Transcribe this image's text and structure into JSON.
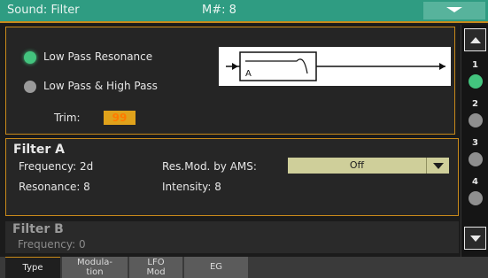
{
  "title_bar": {
    "left_text": "Sound: Filter",
    "center_text": "M#: 8",
    "menu_icon": "chevron-down-icon"
  },
  "filter_type": {
    "option_1": "Low Pass Resonance",
    "option_2": "Low Pass & High Pass",
    "selected": "Low Pass Resonance",
    "trim_label": "Trim:",
    "trim_value": "99"
  },
  "diagram": {
    "letter": "A"
  },
  "filter_a": {
    "heading": "Filter A",
    "frequency": "Frequency: 2d",
    "resonance": "Resonance: 8",
    "res_mod_label": "Res.Mod. by AMS:",
    "res_mod_value": "Off",
    "intensity": "Intensity: 8"
  },
  "filter_b": {
    "heading": "Filter B",
    "frequency": "Frequency: 0"
  },
  "sidebar": {
    "pages": [
      "1",
      "2",
      "3",
      "4"
    ],
    "active_page": "1"
  },
  "tabs": [
    {
      "label": "Type"
    },
    {
      "label1": "Modula-",
      "label2": "tion"
    },
    {
      "label1": "LFO",
      "label2": "Mod"
    },
    {
      "label": "EG"
    }
  ],
  "colors": {
    "accent": "#c98a1a",
    "title_bar": "#2f9c82",
    "led_on": "#43c47e",
    "led_off": "#8f8f8f",
    "trim_box": "#e0a21b",
    "dropdown": "#cfcf9a"
  }
}
